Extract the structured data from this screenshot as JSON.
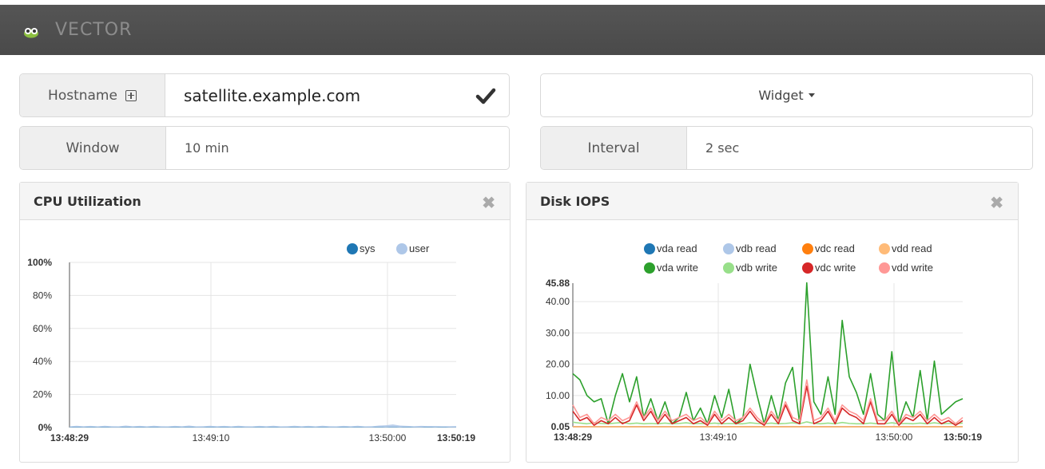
{
  "app": {
    "brand": "VECTOR"
  },
  "form": {
    "hostname_label": "Hostname",
    "hostname_value": "satellite.example.com",
    "widget_label": "Widget",
    "window_label": "Window",
    "window_value": "10 min",
    "interval_label": "Interval",
    "interval_value": "2 sec"
  },
  "panels": {
    "cpu": {
      "title": "CPU Utilization",
      "close": "✖"
    },
    "disk": {
      "title": "Disk IOPS",
      "close": "✖"
    }
  },
  "chart_data": [
    {
      "type": "area",
      "title": "CPU Utilization",
      "ylim": [
        0,
        100
      ],
      "ytick_labels": [
        "100%",
        "80%",
        "60%",
        "40%",
        "20%",
        "0%"
      ],
      "xtick_labels": [
        "13:48:29",
        "13:49:10",
        "13:50:00",
        "13:50:19"
      ],
      "x_range": [
        "13:48:29",
        "13:50:19"
      ],
      "legend_position": "top-right",
      "series": [
        {
          "name": "sys",
          "color": "#1f77b4",
          "values": [
            0.2,
            0.3,
            0.2,
            0.3,
            0.2,
            0.3,
            0.2,
            0.2,
            0.3,
            0.2,
            0.3,
            0.2,
            0.3,
            0.2,
            0.2,
            0.3,
            0.2,
            0.3,
            0.2,
            0.2,
            0.3,
            0.2,
            0.3,
            0.2,
            0.3,
            0.2,
            0.2,
            0.3,
            0.2,
            0.3,
            0.2,
            0.2,
            0.3,
            0.2,
            0.3,
            0.2,
            0.3,
            0.2,
            0.2,
            0.3,
            0.2,
            0.3,
            0.2,
            0.2,
            0.3,
            0.2,
            0.3,
            0.2,
            0.3,
            0.2,
            0.2,
            0.3,
            0.2,
            0.3,
            0.2,
            0.2
          ]
        },
        {
          "name": "user",
          "color": "#aec7e8",
          "values": [
            0.5,
            0.8,
            0.6,
            0.7,
            0.5,
            0.8,
            0.6,
            0.5,
            0.9,
            0.6,
            0.7,
            0.5,
            0.8,
            0.6,
            0.5,
            0.7,
            0.6,
            0.9,
            0.5,
            0.6,
            0.8,
            0.6,
            0.7,
            0.5,
            0.8,
            0.6,
            0.5,
            0.7,
            0.6,
            0.8,
            0.5,
            0.6,
            0.8,
            0.6,
            0.7,
            0.5,
            0.8,
            0.6,
            0.5,
            0.7,
            0.6,
            0.8,
            0.5,
            0.6,
            0.9,
            1.2,
            1.6,
            1.0,
            0.7,
            0.6,
            0.8,
            0.6,
            0.7,
            0.5,
            0.6,
            0.7
          ]
        }
      ]
    },
    {
      "type": "line",
      "title": "Disk IOPS",
      "ylim": [
        0.05,
        45.88
      ],
      "ytick_labels": [
        "45.88",
        "40.00",
        "30.00",
        "20.00",
        "10.00",
        "0.05"
      ],
      "ytick_values": [
        45.88,
        40,
        30,
        20,
        10,
        0.05
      ],
      "xtick_labels": [
        "13:48:29",
        "13:49:10",
        "13:50:00",
        "13:50:19"
      ],
      "legend_position": "top",
      "series": [
        {
          "name": "vda read",
          "color": "#1f77b4",
          "values": [
            0.05,
            0.05,
            0.05,
            0.05,
            0.05,
            0.05,
            0.05,
            0.05,
            0.05,
            0.05,
            0.05,
            0.05,
            0.05,
            0.05,
            0.05,
            0.05,
            0.05,
            0.05,
            0.05,
            0.05,
            0.05,
            0.05,
            0.05,
            0.05,
            0.05,
            0.05,
            0.05,
            0.05,
            0.05,
            0.05,
            0.05,
            0.05,
            0.05,
            0.05,
            0.05,
            0.05,
            0.05,
            0.05,
            0.05,
            0.05,
            0.05,
            0.05,
            0.05,
            0.05,
            0.05,
            0.05,
            0.05,
            0.05,
            0.05,
            0.05,
            0.05,
            0.05,
            0.05,
            0.05,
            0.05,
            0.05
          ]
        },
        {
          "name": "vdb read",
          "color": "#aec7e8",
          "values": [
            0.05,
            0.05,
            0.05,
            0.05,
            0.05,
            0.05,
            0.05,
            0.05,
            0.05,
            0.05,
            0.05,
            0.05,
            0.05,
            0.05,
            0.05,
            0.05,
            0.05,
            0.05,
            0.05,
            0.05,
            0.05,
            0.05,
            0.05,
            0.05,
            0.05,
            0.05,
            0.05,
            0.05,
            0.05,
            0.05,
            0.05,
            0.05,
            0.05,
            0.05,
            0.05,
            0.05,
            0.05,
            0.05,
            0.05,
            0.05,
            0.05,
            0.05,
            0.05,
            0.05,
            0.05,
            0.05,
            0.05,
            0.05,
            0.05,
            0.05,
            0.05,
            0.05,
            0.05,
            0.05,
            0.05,
            0.05
          ]
        },
        {
          "name": "vdc read",
          "color": "#ff7f0e",
          "values": [
            0.05,
            0.05,
            0.05,
            0.05,
            0.05,
            0.05,
            0.05,
            0.05,
            0.05,
            0.05,
            0.05,
            0.05,
            0.05,
            0.05,
            0.05,
            0.05,
            0.05,
            0.05,
            0.05,
            0.05,
            0.05,
            0.05,
            0.05,
            0.05,
            0.05,
            0.05,
            0.05,
            0.05,
            0.05,
            0.05,
            0.05,
            0.05,
            0.05,
            0.05,
            0.05,
            0.05,
            0.05,
            0.05,
            0.05,
            0.05,
            0.05,
            0.05,
            0.05,
            0.05,
            0.05,
            0.05,
            0.05,
            0.05,
            0.05,
            0.05,
            0.05,
            0.05,
            0.05,
            0.05,
            0.05,
            0.05
          ]
        },
        {
          "name": "vdd read",
          "color": "#ffbb78",
          "values": [
            0.05,
            0.05,
            0.05,
            0.05,
            0.05,
            0.05,
            0.05,
            0.05,
            0.05,
            0.05,
            0.05,
            0.05,
            0.05,
            0.05,
            0.05,
            0.05,
            0.05,
            0.05,
            0.05,
            0.05,
            0.05,
            0.05,
            0.05,
            0.05,
            0.05,
            0.05,
            0.05,
            0.05,
            0.05,
            0.05,
            0.05,
            0.05,
            0.05,
            0.05,
            0.05,
            0.05,
            0.05,
            0.05,
            0.05,
            0.05,
            0.05,
            0.05,
            0.05,
            0.05,
            0.05,
            0.05,
            0.05,
            0.05,
            0.05,
            0.05,
            0.05,
            0.05,
            0.05,
            0.05,
            0.05,
            0.05
          ]
        },
        {
          "name": "vda write",
          "color": "#2ca02c",
          "values": [
            17,
            15,
            10,
            8,
            9,
            1,
            10,
            17,
            8,
            16,
            3,
            9,
            2,
            8,
            1,
            3,
            11,
            2,
            6,
            1,
            10,
            3,
            12,
            1,
            3,
            20,
            10,
            1,
            10,
            2,
            14,
            19,
            1,
            46,
            8,
            4,
            16,
            4,
            34,
            16,
            11,
            4,
            17,
            4,
            2,
            24,
            1,
            8,
            3,
            18,
            2,
            21,
            4,
            6,
            8,
            9
          ]
        },
        {
          "name": "vdb write",
          "color": "#98df8a",
          "values": [
            1.5,
            1.2,
            1,
            1.3,
            1.1,
            1,
            1.2,
            1.4,
            1,
            1.2,
            1,
            1.1,
            1,
            1.2,
            1,
            1.1,
            1.3,
            1,
            1.1,
            1,
            1.2,
            1,
            1.1,
            1,
            1,
            1.3,
            1.1,
            1,
            1.2,
            1,
            1.1,
            1.3,
            1,
            1.6,
            1.1,
            1,
            1.2,
            1,
            1.4,
            1.1,
            1,
            1,
            1.2,
            1,
            1,
            1.3,
            1,
            1.1,
            1,
            1.2,
            1,
            1.3,
            1,
            1.1,
            1,
            1.2
          ]
        },
        {
          "name": "vdc write",
          "color": "#d62728",
          "values": [
            5,
            2,
            3,
            0.5,
            2,
            1,
            3,
            1,
            2,
            7,
            2,
            5,
            1,
            4,
            1,
            2,
            3,
            1,
            2,
            0.5,
            4,
            1,
            3,
            1,
            2,
            5,
            2,
            0.5,
            4,
            1,
            7,
            2,
            1,
            13,
            1,
            2,
            5,
            1,
            6,
            4,
            3,
            1,
            8,
            1,
            1,
            4,
            0.5,
            3,
            2,
            4,
            1,
            3,
            1,
            2,
            0.5,
            2
          ]
        },
        {
          "name": "vdd write",
          "color": "#ff9896",
          "values": [
            7,
            3,
            4,
            1,
            3,
            2,
            4,
            2,
            3,
            8,
            3,
            6,
            2,
            5,
            2,
            3,
            4,
            2,
            3,
            1,
            5,
            2,
            4,
            2,
            3,
            6,
            3,
            1,
            5,
            2,
            8,
            3,
            2,
            15,
            2,
            3,
            6,
            2,
            7,
            5,
            4,
            2,
            9,
            2,
            2,
            5,
            1,
            4,
            3,
            5,
            2,
            4,
            2,
            3,
            1,
            3
          ]
        }
      ]
    }
  ]
}
